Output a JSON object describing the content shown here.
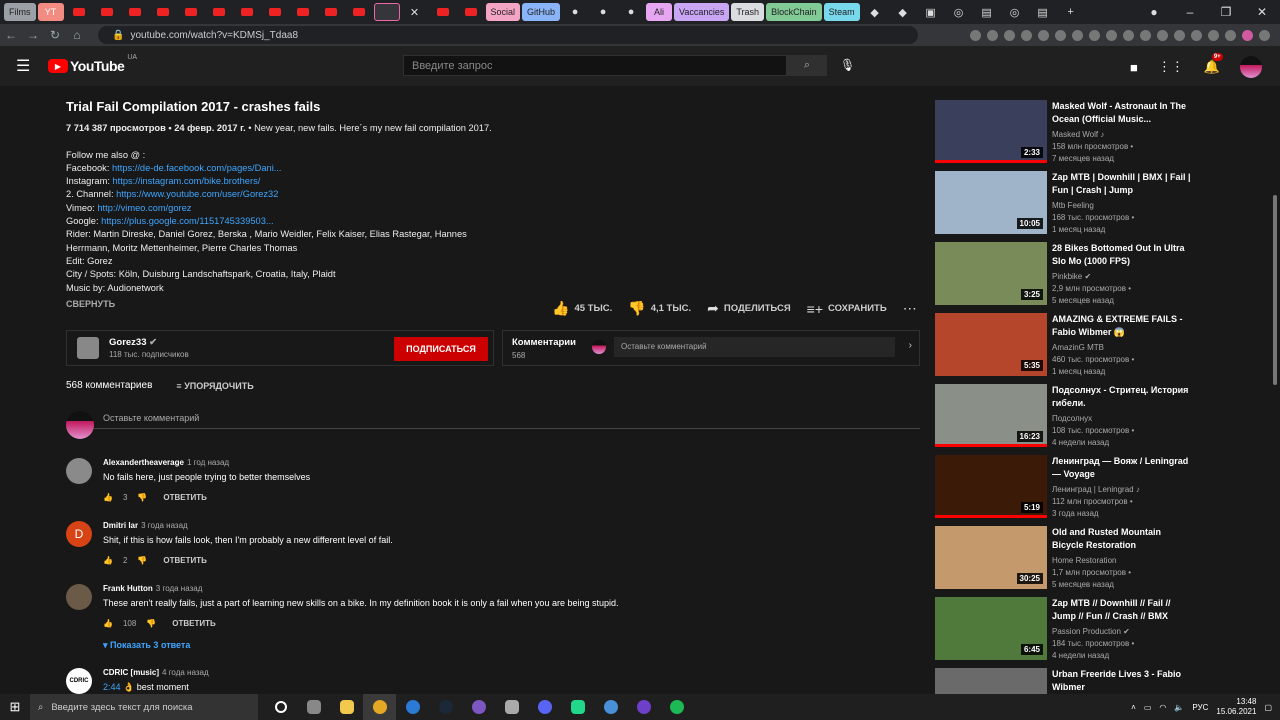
{
  "browser": {
    "tabs": [
      "Films",
      "YT",
      "Social",
      "GitHub",
      "Ali",
      "Vaccancies",
      "Trash",
      "BlockChain",
      "Steam"
    ],
    "url": "youtube.com/watch?v=KDMSj_Tdaa8"
  },
  "header": {
    "logo": "YouTube",
    "region": "UA",
    "search_placeholder": "Введите запрос",
    "notif_badge": "9+"
  },
  "video": {
    "title": "Trial Fail Compilation 2017 - crashes fails",
    "stats": "7 714 387 просмотров • 24 февр. 2017 г.",
    "desc_first": " • New year, new fails. Here´s my new fail compilation 2017.",
    "follow": "Follow me also @ :",
    "links": [
      {
        "label": "Facebook: ",
        "url": "https://de-de.facebook.com/pages/Dani..."
      },
      {
        "label": "Instagram: ",
        "url": "https://instagram.com/bike.brothers/"
      },
      {
        "label": "2. Channel: ",
        "url": "https://www.youtube.com/user/Gorez32"
      },
      {
        "label": "Vimeo: ",
        "url": "http://vimeo.com/gorez"
      },
      {
        "label": "Google: ",
        "url": "https://plus.google.com/1151745339503..."
      }
    ],
    "riders": "Rider: Martin Direske,  Daniel Gorez, Berska , Mario Weidler, Felix Kaiser, Elias Rastegar, Hannes Herrmann, Moritz Mettenheimer, Pierre Charles Thomas",
    "edit": "Edit:  Gorez",
    "city": "City / Spots: Köln, Duisburg Landschaftspark, Croatia, Italy, Plaidt",
    "music": "Music by: Audionetwork",
    "collapse": "СВЕРНУТЬ",
    "likes": "45 ТЫС.",
    "dislikes": "4,1 ТЫС.",
    "share": "ПОДЕЛИТЬСЯ",
    "save": "СОХРАНИТЬ"
  },
  "channel": {
    "name": "Gorez33",
    "subs": "118 тыс. подписчиков",
    "subscribe": "ПОДПИСАТЬСЯ"
  },
  "comments_box": {
    "label": "Комментарии",
    "count": "568",
    "placeholder": "Оставьте комментарий"
  },
  "comments": {
    "header": "568 комментариев",
    "sort": "УПОРЯДОЧИТЬ",
    "add_placeholder": "Оставьте комментарий",
    "reply": "ОТВЕТИТЬ",
    "items": [
      {
        "author": "Alexandertheaverage",
        "time": "1 год назад",
        "text": "No fails here, just people trying to better themselves",
        "likes": "3",
        "avatar": ""
      },
      {
        "author": "Dmitri lar",
        "time": "3 года назад",
        "text": "Shit, if this is how fails look, then I'm probably a new different level of fail.",
        "likes": "2",
        "avatar": "D"
      },
      {
        "author": "Frank Hutton",
        "time": "3 года назад",
        "text": "These aren't really fails, just a part of learning new skills on a bike. In my definition book it is only a fail when you are being stupid.",
        "likes": "108",
        "avatar": "",
        "replies": "Показать 3 ответа"
      },
      {
        "author": "CDRIC [music]",
        "time": "4 года назад",
        "text_time": "2:44",
        "text": " 👌 best moment",
        "likes": "",
        "avatar": "CDRIC"
      }
    ]
  },
  "related": [
    {
      "title": "Masked Wolf - Astronaut In The Ocean (Official Music...",
      "channel": "Masked Wolf ♪",
      "views": "158 млн просмотров •",
      "age": "7 месяцев назад",
      "duration": "2:33",
      "color": "#3a3f5c"
    },
    {
      "title": "Zap MTB | Downhill | BMX | Fail | Fun | Crash | Jump",
      "channel": "Mtb Feeling",
      "views": "168 тыс. просмотров •",
      "age": "1 месяц назад",
      "duration": "10:05",
      "color": "#9fb4c8"
    },
    {
      "title": "28 Bikes Bottomed Out In Ultra Slo Mo (1000 FPS)",
      "channel": "Pinkbike ✔",
      "views": "2,9 млн просмотров •",
      "age": "5 месяцев назад",
      "duration": "3:25",
      "color": "#7a8b5a"
    },
    {
      "title": "AMAZING & EXTREME FAILS - Fabio Wibmer 😱",
      "channel": "AmazinG MTB",
      "views": "460 тыс. просмотров •",
      "age": "1 месяц назад",
      "duration": "5:35",
      "color": "#b5452b"
    },
    {
      "title": "Подсолнух - Стритец. История гибели.",
      "channel": "Подсолнух",
      "views": "108 тыс. просмотров •",
      "age": "4 недели назад",
      "duration": "16:23",
      "color": "#8a8f88"
    },
    {
      "title": "Ленинград — Вояж / Leningrad — Voyage",
      "channel": "Ленинград | Leningrad ♪",
      "views": "112 млн просмотров •",
      "age": "3 года назад",
      "duration": "5:19",
      "color": "#3b1a08"
    },
    {
      "title": "Old and Rusted Mountain Bicycle Restoration",
      "channel": "Home Restoration",
      "views": "1,7 млн просмотров •",
      "age": "5 месяцев назад",
      "duration": "30:25",
      "color": "#c49a6c"
    },
    {
      "title": "Zap MTB // Downhill // Fail // Jump // Fun // Crash // BMX",
      "channel": "Passion Production ✔",
      "views": "184 тыс. просмотров •",
      "age": "4 недели назад",
      "duration": "6:45",
      "color": "#4f7a3c"
    },
    {
      "title": "Urban Freeride Lives 3 - Fabio Wibmer",
      "channel": "",
      "views": "",
      "age": "",
      "duration": "",
      "color": "#6a6a6a"
    }
  ],
  "taskbar": {
    "search": "Введите здесь текст для поиска",
    "lang": "РУС",
    "time": "13:48",
    "date": "15.06.2021"
  }
}
